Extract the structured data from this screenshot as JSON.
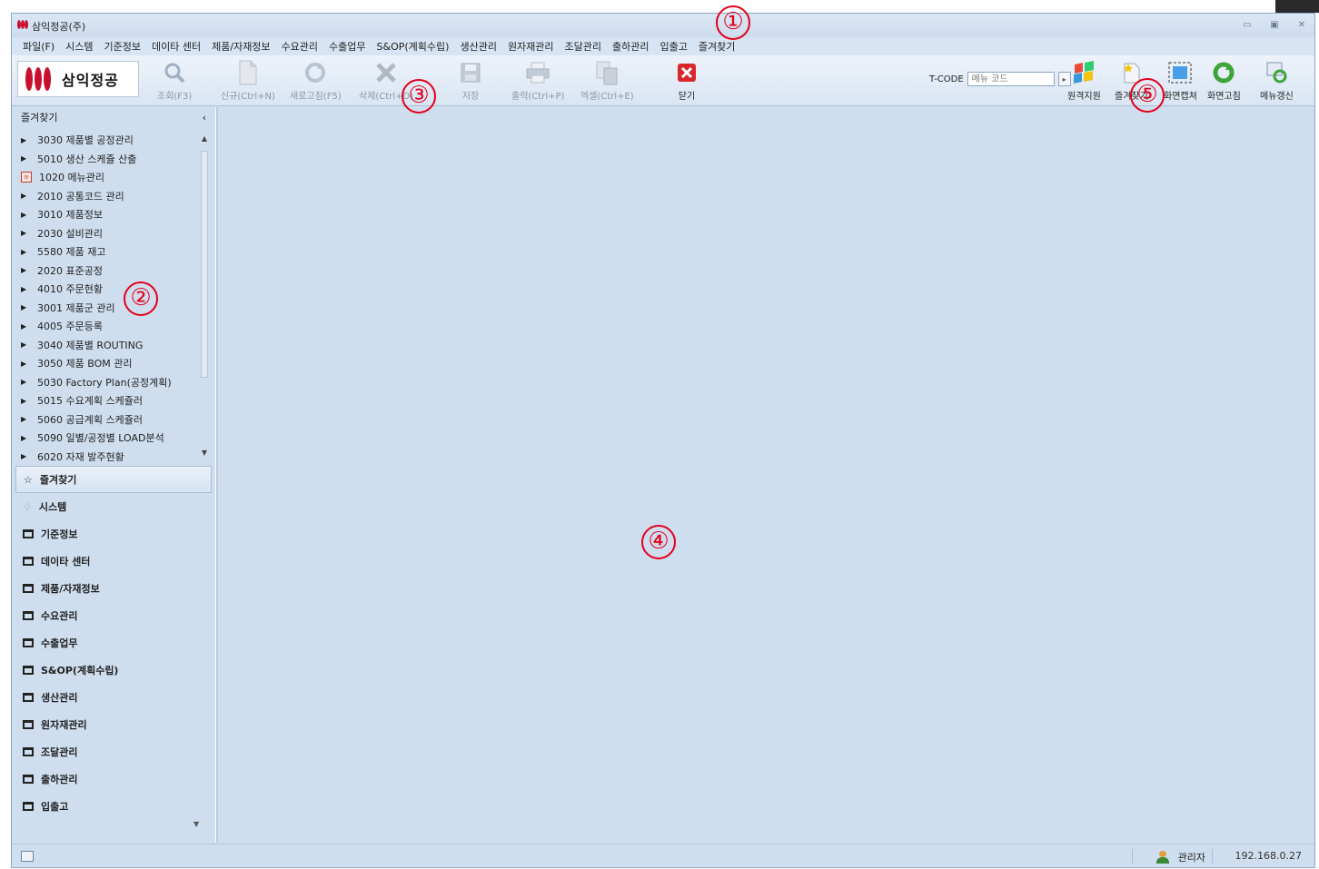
{
  "window": {
    "title": "삼익정공(주)",
    "controls": [
      "minimize",
      "restore",
      "close"
    ]
  },
  "menu": [
    "파일(F)",
    "시스템",
    "기준정보",
    "데이타 센터",
    "제품/자재정보",
    "수요관리",
    "수출업무",
    "S&OP(계획수립)",
    "생산관리",
    "원자재관리",
    "조달관리",
    "출하관리",
    "입출고",
    "즐겨찾기"
  ],
  "toolbar": {
    "company_logo_text": "삼익정공",
    "buttons": [
      {
        "label": "조회(F3)",
        "icon": "search-icon",
        "enabled": false
      },
      {
        "label": "신규(Ctrl+N)",
        "icon": "new-document-icon",
        "enabled": false
      },
      {
        "label": "새로고침(F5)",
        "icon": "refresh-icon",
        "enabled": false
      },
      {
        "label": "삭제(Ctrl+D)",
        "icon": "delete-icon",
        "enabled": false
      },
      {
        "label": "저장",
        "icon": "save-icon",
        "enabled": false
      },
      {
        "label": "출력(Ctrl+P)",
        "icon": "print-icon",
        "enabled": false
      },
      {
        "label": "엑셀(Ctrl+E)",
        "icon": "excel-icon",
        "enabled": false
      },
      {
        "label": "닫기",
        "icon": "close-red-icon",
        "enabled": true
      }
    ],
    "tcode_label": "T-CODE",
    "tcode_placeholder": "메뉴 코드",
    "right_buttons": [
      {
        "label": "원격지원",
        "icon": "remote-support-icon"
      },
      {
        "label": "즐겨찾기",
        "icon": "favorite-add-icon"
      },
      {
        "label": "화면캡쳐",
        "icon": "screen-capture-icon"
      },
      {
        "label": "화면고침",
        "icon": "screen-refresh-icon"
      },
      {
        "label": "메뉴갱신",
        "icon": "menu-refresh-icon"
      }
    ]
  },
  "sidebar": {
    "header": "즐겨찾기",
    "collapse_glyph": "‹",
    "favorites": [
      {
        "label": "3030 제품별 공정관리",
        "type": "arrow"
      },
      {
        "label": "5010 생산 스케쥴 산출",
        "type": "arrow"
      },
      {
        "label": "1020 메뉴관리",
        "type": "doc"
      },
      {
        "label": "2010 공통코드 관리",
        "type": "arrow"
      },
      {
        "label": "3010 제품정보",
        "type": "arrow"
      },
      {
        "label": "2030 설비관리",
        "type": "arrow"
      },
      {
        "label": "5580 제품 재고",
        "type": "arrow"
      },
      {
        "label": "2020 표준공정",
        "type": "arrow"
      },
      {
        "label": "4010 주문현황",
        "type": "arrow"
      },
      {
        "label": "3001 제품군 관리",
        "type": "arrow"
      },
      {
        "label": "4005 주문등록",
        "type": "arrow"
      },
      {
        "label": "3040 제품별 ROUTING",
        "type": "arrow"
      },
      {
        "label": "3050 제품 BOM 관리",
        "type": "arrow"
      },
      {
        "label": "5030 Factory Plan(공정계획)",
        "type": "arrow"
      },
      {
        "label": "5015 수요계획 스케쥴러",
        "type": "arrow"
      },
      {
        "label": "5060 공급계획 스케쥴러",
        "type": "arrow"
      },
      {
        "label": "5090 일별/공정별 LOAD분석",
        "type": "arrow"
      },
      {
        "label": "6020 자재 발주현황",
        "type": "arrow"
      }
    ],
    "groups": [
      {
        "label": "즐겨찾기",
        "icon": "star-icon",
        "selected": true
      },
      {
        "label": "시스템",
        "icon": "gem-icon",
        "selected": false
      },
      {
        "label": "기준정보",
        "icon": "folder-icon",
        "selected": false
      },
      {
        "label": "데이타 센터",
        "icon": "folder-icon",
        "selected": false
      },
      {
        "label": "제품/자재정보",
        "icon": "folder-icon",
        "selected": false
      },
      {
        "label": "수요관리",
        "icon": "folder-icon",
        "selected": false
      },
      {
        "label": "수출업무",
        "icon": "folder-icon",
        "selected": false
      },
      {
        "label": "S&OP(계획수립)",
        "icon": "folder-icon",
        "selected": false
      },
      {
        "label": "생산관리",
        "icon": "folder-icon",
        "selected": false
      },
      {
        "label": "원자재관리",
        "icon": "folder-icon",
        "selected": false
      },
      {
        "label": "조달관리",
        "icon": "folder-icon",
        "selected": false
      },
      {
        "label": "출하관리",
        "icon": "folder-icon",
        "selected": false
      },
      {
        "label": "입출고",
        "icon": "folder-icon",
        "selected": false
      }
    ]
  },
  "status": {
    "user": "관리자",
    "ip": "192.168.0.27"
  },
  "annotations": [
    "①",
    "②",
    "③",
    "④",
    "⑤"
  ],
  "colors": {
    "accent_red": "#e4001b",
    "background": "#cfdeef",
    "brand_red": "#c8102e"
  }
}
